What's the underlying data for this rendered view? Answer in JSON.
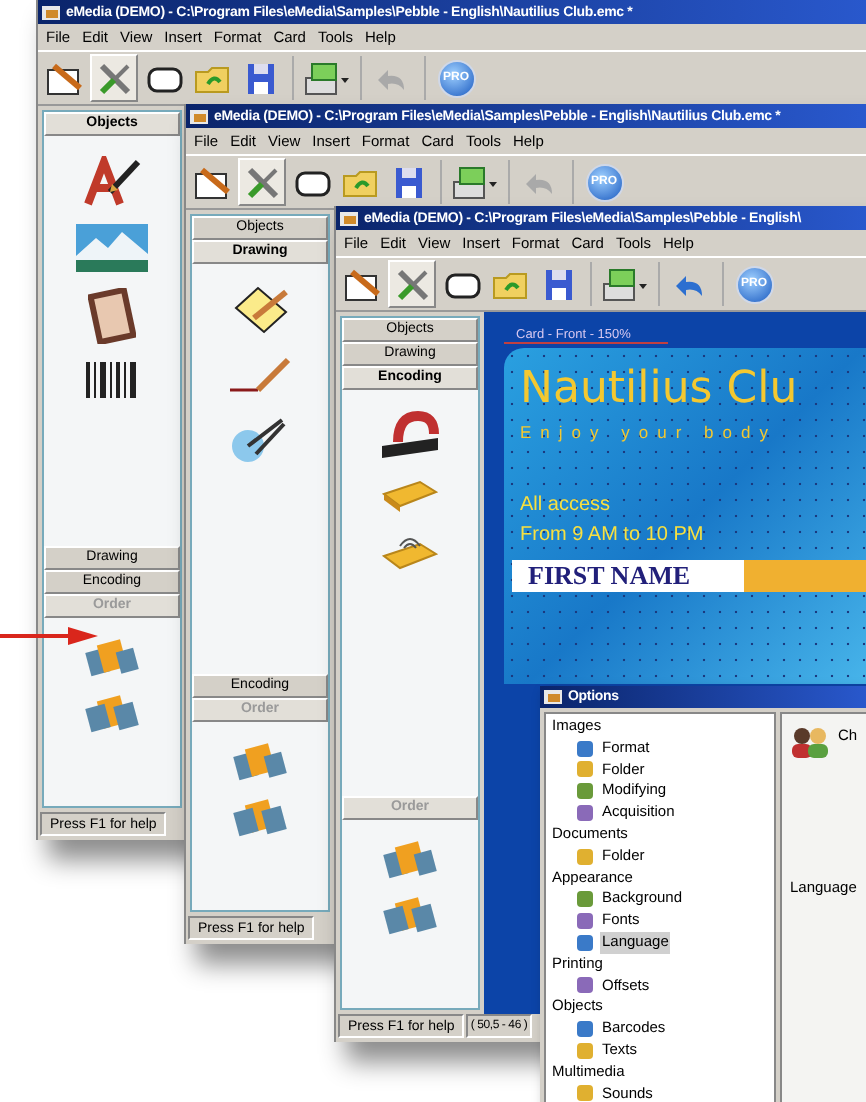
{
  "windows": [
    {
      "title": "eMedia (DEMO)  - C:\\Program Files\\eMedia\\Samples\\Pebble - English\\Nautilius Club.emc *",
      "menu": [
        "File",
        "Edit",
        "View",
        "Insert",
        "Format",
        "Card",
        "Tools",
        "Help"
      ],
      "toolbar": [
        {
          "kind": "edit",
          "pressed": false
        },
        {
          "kind": "tools",
          "pressed": true
        },
        {
          "kind": "card",
          "pressed": false
        },
        {
          "kind": "open",
          "pressed": false
        },
        {
          "kind": "save",
          "pressed": false
        },
        {
          "kind": "print",
          "pressed": false
        },
        {
          "kind": "undo",
          "disabled": true
        },
        {
          "kind": "pro",
          "label": "PRO"
        }
      ],
      "panel": [
        {
          "label": "Objects",
          "expanded": true,
          "disabled": false
        },
        {
          "label": "Drawing",
          "expanded": false,
          "disabled": false
        },
        {
          "label": "Encoding",
          "expanded": false,
          "disabled": false
        },
        {
          "label": "Order",
          "expanded": true,
          "disabled": true
        }
      ],
      "status": [
        "Press F1 for help"
      ]
    },
    {
      "title": "eMedia (DEMO)  - C:\\Program Files\\eMedia\\Samples\\Pebble - English\\Nautilius Club.emc *",
      "menu": [
        "File",
        "Edit",
        "View",
        "Insert",
        "Format",
        "Card",
        "Tools",
        "Help"
      ],
      "toolbar": [
        {
          "kind": "edit",
          "pressed": false
        },
        {
          "kind": "tools",
          "pressed": true
        },
        {
          "kind": "card",
          "pressed": false
        },
        {
          "kind": "open",
          "pressed": false
        },
        {
          "kind": "save",
          "pressed": false
        },
        {
          "kind": "print",
          "pressed": false
        },
        {
          "kind": "undo",
          "disabled": true
        },
        {
          "kind": "pro",
          "label": "PRO"
        }
      ],
      "panel": [
        {
          "label": "Objects",
          "expanded": false,
          "disabled": false
        },
        {
          "label": "Drawing",
          "expanded": true,
          "disabled": false
        },
        {
          "label": "Encoding",
          "expanded": false,
          "disabled": false
        },
        {
          "label": "Order",
          "expanded": true,
          "disabled": true
        }
      ],
      "status": [
        "Press F1 for help"
      ]
    },
    {
      "title": "eMedia (DEMO)  - C:\\Program Files\\eMedia\\Samples\\Pebble - English\\",
      "menu": [
        "File",
        "Edit",
        "View",
        "Insert",
        "Format",
        "Card",
        "Tools",
        "Help"
      ],
      "toolbar": [
        {
          "kind": "edit",
          "pressed": false
        },
        {
          "kind": "tools",
          "pressed": true
        },
        {
          "kind": "card",
          "pressed": false
        },
        {
          "kind": "open",
          "pressed": false
        },
        {
          "kind": "save",
          "pressed": false
        },
        {
          "kind": "print",
          "pressed": false
        },
        {
          "kind": "undo",
          "disabled": false
        },
        {
          "kind": "pro",
          "label": "PRO"
        }
      ],
      "panel": [
        {
          "label": "Objects",
          "expanded": false,
          "disabled": false
        },
        {
          "label": "Drawing",
          "expanded": false,
          "disabled": false
        },
        {
          "label": "Encoding",
          "expanded": true,
          "disabled": false
        },
        {
          "label": "Order",
          "expanded": true,
          "disabled": true
        }
      ],
      "status": [
        "Press F1 for help",
        "( 50,5 - 46 )"
      ],
      "canvas": {
        "caption": "Card - Front - 150%",
        "card": {
          "title": "Nautilius Clu",
          "tagline": "Enjoy your body",
          "access": "All access",
          "hours": "From 9 AM to 10 PM",
          "name_field": "FIRST NAME"
        }
      }
    }
  ],
  "options": {
    "title": "Options",
    "tree": [
      {
        "label": "Images",
        "selected": false,
        "children": [
          {
            "label": "Format",
            "selected": false
          },
          {
            "label": "Folder",
            "selected": false
          },
          {
            "label": "Modifying",
            "selected": false
          },
          {
            "label": "Acquisition",
            "selected": false
          }
        ]
      },
      {
        "label": "Documents",
        "selected": false,
        "children": [
          {
            "label": "Folder",
            "selected": false
          }
        ]
      },
      {
        "label": "Appearance",
        "selected": false,
        "children": [
          {
            "label": "Background",
            "selected": false
          },
          {
            "label": "Fonts",
            "selected": false
          },
          {
            "label": "Language",
            "selected": true
          }
        ]
      },
      {
        "label": "Printing",
        "selected": false,
        "children": [
          {
            "label": "Offsets",
            "selected": false
          }
        ]
      },
      {
        "label": "Objects",
        "selected": false,
        "children": [
          {
            "label": "Barcodes",
            "selected": false
          },
          {
            "label": "Texts",
            "selected": false
          }
        ]
      },
      {
        "label": "Multimedia",
        "selected": false,
        "children": [
          {
            "label": "Sounds",
            "selected": false
          }
        ]
      }
    ],
    "heading": "Ch",
    "field_label": "Language"
  }
}
